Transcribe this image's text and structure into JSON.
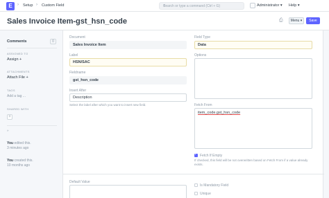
{
  "navbar": {
    "logo": "E",
    "breadcrumbs": [
      "Setup",
      "Custom Field"
    ],
    "search_placeholder": "Search or type a command (Ctrl + G)",
    "user": "Administrator ▾",
    "help": "Help ▾"
  },
  "page": {
    "title": "Sales Invoice Item-gst_hsn_code",
    "menu_label": "Menu ▾",
    "save_label": "Save"
  },
  "sidebar": {
    "comments_label": "Comments",
    "comments_count": "0",
    "assigned_label": "ASSIGNED TO",
    "assign_action": "Assign +",
    "attachments_label": "ATTACHMENTS",
    "attach_action": "Attach File +",
    "tags_label": "TAGS",
    "add_tag": "Add a tag ...",
    "shared_label": "SHARED WITH",
    "shared_plus": "+",
    "separator": "»",
    "activity": [
      {
        "who": "You",
        "action": " edited this.",
        "when": "3 minutes ago"
      },
      {
        "who": "You",
        "action": " created this.",
        "when": "10 months ago"
      }
    ]
  },
  "form": {
    "document": {
      "label": "Document",
      "value": "Sales Invoice Item"
    },
    "label": {
      "label": "Label",
      "value": "HSN/SAC"
    },
    "fieldname": {
      "label": "Fieldname",
      "value": "gst_hsn_code"
    },
    "insert_after": {
      "label": "Insert After",
      "value": "Description",
      "description": "Select the label after which you want to insert new field."
    },
    "field_type": {
      "label": "Field Type",
      "value": "Data"
    },
    "options": {
      "label": "Options",
      "value": ""
    },
    "fetch_from": {
      "label": "Fetch From",
      "value": "item_code.gst_hsn_code"
    },
    "fetch_if_empty": {
      "label": "Fetch If Empty",
      "checked": true,
      "description": "If checked, this field will be not overwritten based on Fetch From if a value already exists."
    },
    "default_value": {
      "label": "Default Value"
    },
    "is_mandatory": {
      "label": "Is Mandatory Field",
      "checked": false
    },
    "unique": {
      "label": "Unique",
      "checked": false
    }
  },
  "colors": {
    "primary": "#5e64ff",
    "border": "#d1d8dd",
    "muted_text": "#8d99a6",
    "text": "#36414c",
    "yellow_field": "#fffdf4"
  }
}
